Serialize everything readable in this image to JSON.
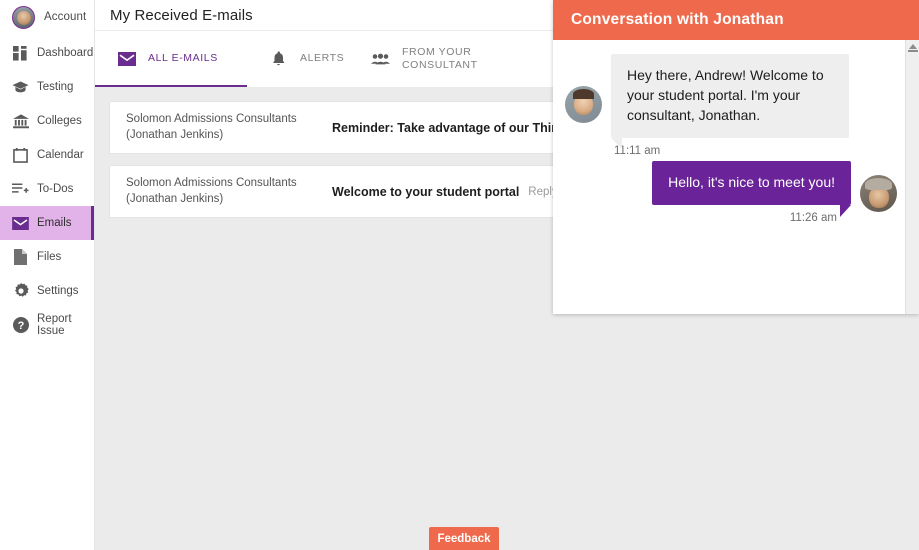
{
  "sidebar": {
    "account": {
      "label": "Account",
      "icon": "user-avatar"
    },
    "items": [
      {
        "label": "Dashboard",
        "icon": "dashboard-icon"
      },
      {
        "label": "Testing",
        "icon": "graduation-cap-icon"
      },
      {
        "label": "Colleges",
        "icon": "bank-icon"
      },
      {
        "label": "Calendar",
        "icon": "calendar-icon"
      },
      {
        "label": "To-Dos",
        "icon": "list-plus-icon"
      },
      {
        "label": "Emails",
        "icon": "envelope-icon"
      },
      {
        "label": "Files",
        "icon": "file-icon"
      },
      {
        "label": "Settings",
        "icon": "gear-icon"
      },
      {
        "label": "Report Issue",
        "icon": "question-circle-icon"
      }
    ],
    "active_item": "Emails"
  },
  "header": {
    "title": "My Received E-mails"
  },
  "tabs": [
    {
      "label": "ALL E-MAILS",
      "icon": "envelope-icon",
      "active": true
    },
    {
      "label": "ALERTS",
      "icon": "bell-icon",
      "active": false
    },
    {
      "label": "FROM YOUR\nCONSULTANT",
      "icon": "people-icon",
      "active": false
    }
  ],
  "emails": [
    {
      "sender": "Solomon Admissions Consultants (Jonathan Jenkins)",
      "subject": "Reminder: Take advantage of our ThinkVault!",
      "preview": ""
    },
    {
      "sender": "Solomon Admissions Consultants (Jonathan Jenkins)",
      "subject": "Welcome to your student portal",
      "preview": "Reply to jonath"
    }
  ],
  "feedback": {
    "label": "Feedback"
  },
  "chat": {
    "title": "Conversation with Jonathan",
    "messages": [
      {
        "from": "them",
        "text": "Hey there, Andrew! Welcome to your student portal. I'm your consultant, Jonathan.",
        "time": "11:11 am"
      },
      {
        "from": "me",
        "text": "Hello, it's nice to meet you!",
        "time": "11:26 am"
      }
    ]
  },
  "colors": {
    "accent_purple": "#6a2d8f",
    "bubble_purple": "#6a2398",
    "accent_orange": "#ef6a4c",
    "active_nav_bg": "#e2b3e8",
    "page_bg": "#ebebeb"
  }
}
